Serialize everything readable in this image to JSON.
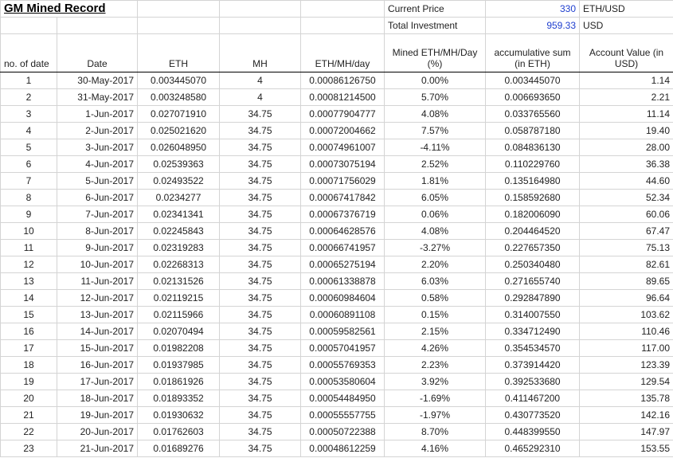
{
  "title": "GM Mined Record",
  "summary": {
    "current_price_label": "Current Price",
    "current_price_value": "330",
    "current_price_unit": "ETH/USD",
    "total_investment_label": "Total Investment",
    "total_investment_value": "959.33",
    "total_investment_unit": "USD"
  },
  "columns": [
    "no. of date",
    "Date",
    "ETH",
    "MH",
    "ETH/MH/day",
    "Mined ETH/MH/Day (%)",
    "accumulative sum (in ETH)",
    "Account Value (in USD)"
  ],
  "rows": [
    [
      "1",
      "30-May-2017",
      "0.003445070",
      "4",
      "0.00086126750",
      "0.00%",
      "0.003445070",
      "1.14"
    ],
    [
      "2",
      "31-May-2017",
      "0.003248580",
      "4",
      "0.00081214500",
      "5.70%",
      "0.006693650",
      "2.21"
    ],
    [
      "3",
      "1-Jun-2017",
      "0.027071910",
      "34.75",
      "0.00077904777",
      "4.08%",
      "0.033765560",
      "11.14"
    ],
    [
      "4",
      "2-Jun-2017",
      "0.025021620",
      "34.75",
      "0.00072004662",
      "7.57%",
      "0.058787180",
      "19.40"
    ],
    [
      "5",
      "3-Jun-2017",
      "0.026048950",
      "34.75",
      "0.00074961007",
      "-4.11%",
      "0.084836130",
      "28.00"
    ],
    [
      "6",
      "4-Jun-2017",
      "0.02539363",
      "34.75",
      "0.00073075194",
      "2.52%",
      "0.110229760",
      "36.38"
    ],
    [
      "7",
      "5-Jun-2017",
      "0.02493522",
      "34.75",
      "0.00071756029",
      "1.81%",
      "0.135164980",
      "44.60"
    ],
    [
      "8",
      "6-Jun-2017",
      "0.0234277",
      "34.75",
      "0.00067417842",
      "6.05%",
      "0.158592680",
      "52.34"
    ],
    [
      "9",
      "7-Jun-2017",
      "0.02341341",
      "34.75",
      "0.00067376719",
      "0.06%",
      "0.182006090",
      "60.06"
    ],
    [
      "10",
      "8-Jun-2017",
      "0.02245843",
      "34.75",
      "0.00064628576",
      "4.08%",
      "0.204464520",
      "67.47"
    ],
    [
      "11",
      "9-Jun-2017",
      "0.02319283",
      "34.75",
      "0.00066741957",
      "-3.27%",
      "0.227657350",
      "75.13"
    ],
    [
      "12",
      "10-Jun-2017",
      "0.02268313",
      "34.75",
      "0.00065275194",
      "2.20%",
      "0.250340480",
      "82.61"
    ],
    [
      "13",
      "11-Jun-2017",
      "0.02131526",
      "34.75",
      "0.00061338878",
      "6.03%",
      "0.271655740",
      "89.65"
    ],
    [
      "14",
      "12-Jun-2017",
      "0.02119215",
      "34.75",
      "0.00060984604",
      "0.58%",
      "0.292847890",
      "96.64"
    ],
    [
      "15",
      "13-Jun-2017",
      "0.02115966",
      "34.75",
      "0.00060891108",
      "0.15%",
      "0.314007550",
      "103.62"
    ],
    [
      "16",
      "14-Jun-2017",
      "0.02070494",
      "34.75",
      "0.00059582561",
      "2.15%",
      "0.334712490",
      "110.46"
    ],
    [
      "17",
      "15-Jun-2017",
      "0.01982208",
      "34.75",
      "0.00057041957",
      "4.26%",
      "0.354534570",
      "117.00"
    ],
    [
      "18",
      "16-Jun-2017",
      "0.01937985",
      "34.75",
      "0.00055769353",
      "2.23%",
      "0.373914420",
      "123.39"
    ],
    [
      "19",
      "17-Jun-2017",
      "0.01861926",
      "34.75",
      "0.00053580604",
      "3.92%",
      "0.392533680",
      "129.54"
    ],
    [
      "20",
      "18-Jun-2017",
      "0.01893352",
      "34.75",
      "0.00054484950",
      "-1.69%",
      "0.411467200",
      "135.78"
    ],
    [
      "21",
      "19-Jun-2017",
      "0.01930632",
      "34.75",
      "0.00055557755",
      "-1.97%",
      "0.430773520",
      "142.16"
    ],
    [
      "22",
      "20-Jun-2017",
      "0.01762603",
      "34.75",
      "0.00050722388",
      "8.70%",
      "0.448399550",
      "147.97"
    ],
    [
      "23",
      "21-Jun-2017",
      "0.01689276",
      "34.75",
      "0.00048612259",
      "4.16%",
      "0.465292310",
      "153.55"
    ]
  ]
}
